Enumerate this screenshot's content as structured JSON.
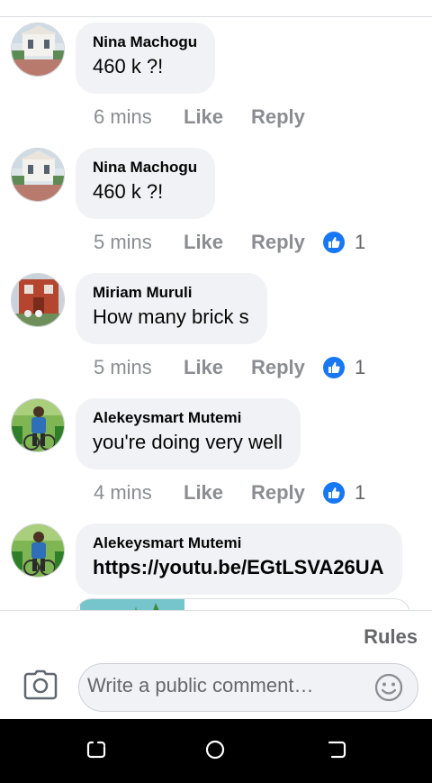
{
  "comments": [
    {
      "author": "Nina Machogu",
      "text": "460 k ?!",
      "time": "6 mins",
      "like": "Like",
      "reply": "Reply",
      "reactions": ""
    },
    {
      "author": "Nina Machogu",
      "text": "460 k ?!",
      "time": "5 mins",
      "like": "Like",
      "reply": "Reply",
      "reactions": "1"
    },
    {
      "author": "Miriam Muruli",
      "text": "How many brick s",
      "time": "5 mins",
      "like": "Like",
      "reply": "Reply",
      "reactions": "1"
    },
    {
      "author": "Alekeysmart Mutemi",
      "text": "you're doing very well",
      "time": "4 mins",
      "like": "Like",
      "reply": "Reply",
      "reactions": "1"
    },
    {
      "author": "Alekeysmart Mutemi",
      "text": "https://youtu.be/EGtLSVA26UA"
    }
  ],
  "footer": {
    "rules": "Rules",
    "comment_placeholder": "Write a public comment…"
  },
  "icons": {
    "like_badge": "thumbs-up-icon",
    "camera": "camera-icon",
    "emoji": "smiley-icon",
    "nav": [
      "recent-apps-icon",
      "home-icon",
      "back-icon"
    ]
  },
  "colors": {
    "bubble": "#f0f2f5",
    "meta_text": "#8a8d91",
    "like_badge": "#1877f2",
    "navbar": "#000000"
  }
}
